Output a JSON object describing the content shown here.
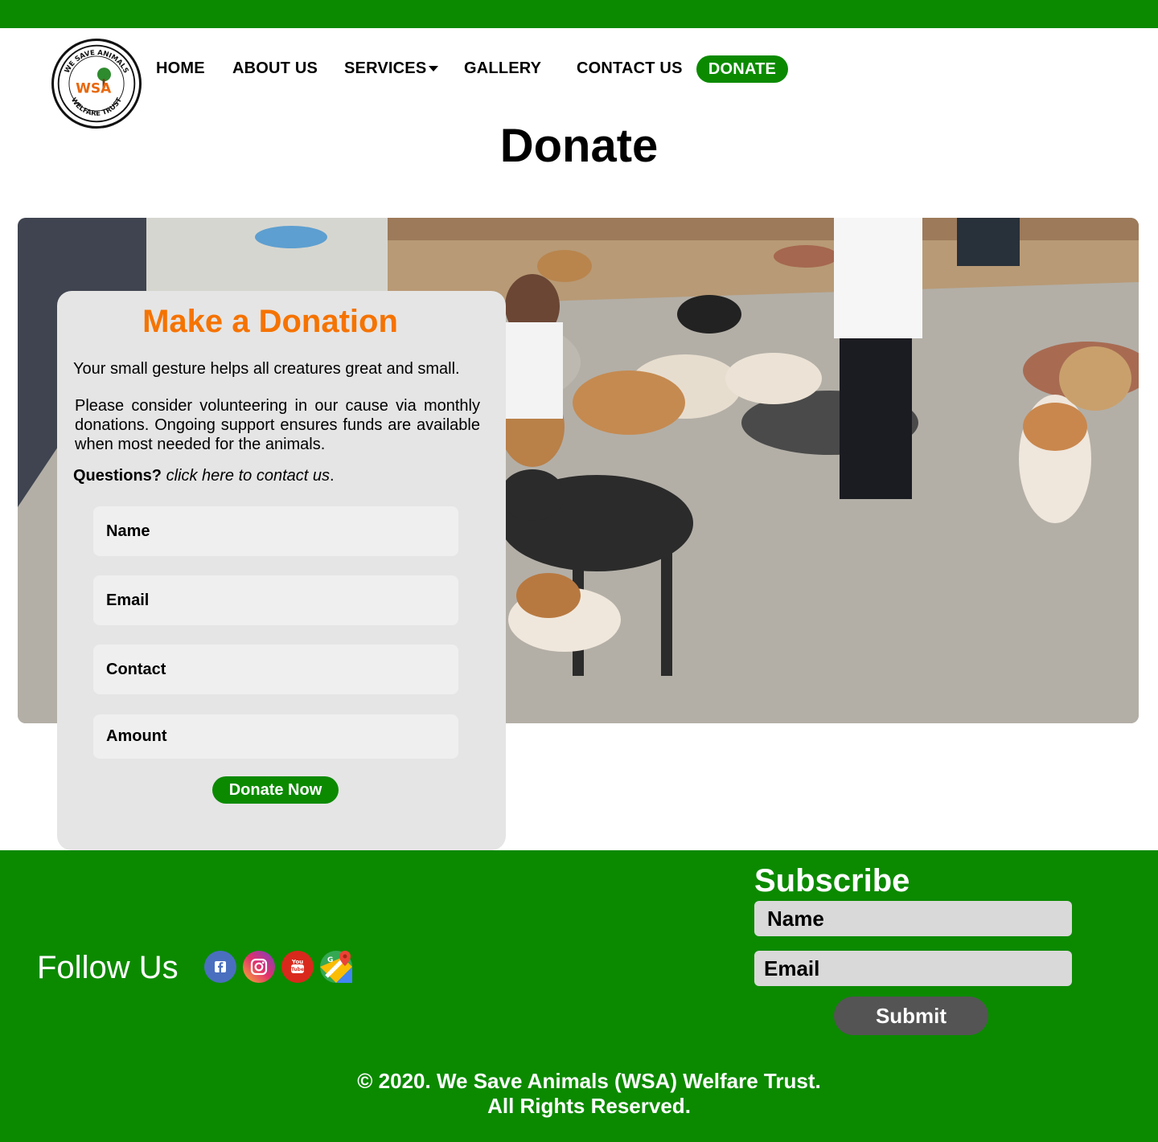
{
  "brand": {
    "logo_text_top": "WE SAVE ANIMALS",
    "logo_text_mid": "WSA",
    "logo_text_bottom": "WELFARE TRUST"
  },
  "nav": {
    "home": "HOME",
    "about": "ABOUT US",
    "services": "SERVICES",
    "gallery": "GALLERY",
    "contact": "CONTACT US",
    "donate": "DONATE"
  },
  "page": {
    "title": "Donate"
  },
  "donation_card": {
    "title": "Make a Donation",
    "lead": "Your small gesture helps all creatures great and small.",
    "paragraph": "Please consider volunteering in our cause via monthly donations. Ongoing support ensures funds are available when most needed for the animals.",
    "questions_label": "Questions?",
    "contact_link": "click here to contact us",
    "contact_suffix": ".",
    "fields": {
      "name": "Name",
      "email": "Email",
      "contact": "Contact",
      "amount": "Amount"
    },
    "submit": "Donate Now"
  },
  "footer": {
    "follow_us": "Follow Us",
    "social_icons": [
      "facebook-icon",
      "instagram-icon",
      "youtube-icon",
      "google-maps-icon"
    ],
    "subscribe_title": "Subscribe",
    "subscribe_name": "Name",
    "subscribe_email": "Email",
    "submit": "Submit",
    "copyright_line1": "© 2020. We Save Animals (WSA) Welfare Trust.",
    "copyright_line2": "All Rights Reserved."
  },
  "colors": {
    "brand_green": "#0b8a00",
    "accent_orange": "#f57300",
    "card_bg": "#e5e5e5",
    "submit_gray": "#545454"
  }
}
